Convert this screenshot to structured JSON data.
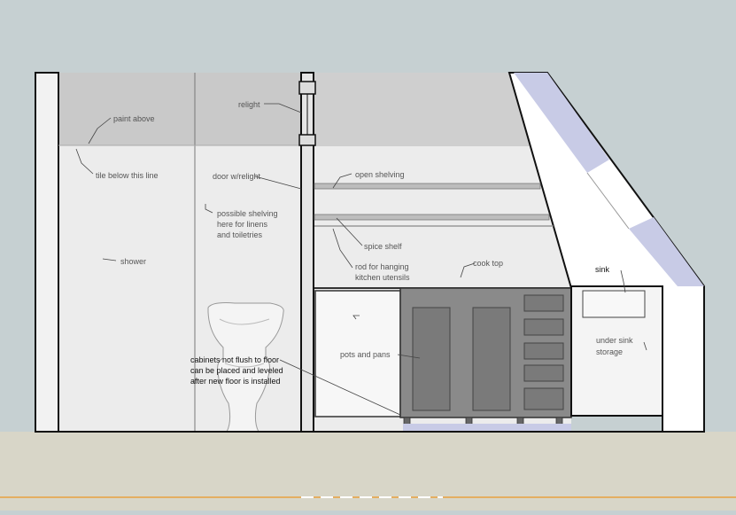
{
  "labels": {
    "paint_above": "paint above",
    "tile_below": "tile below this line",
    "shower": "shower",
    "relight": "relight",
    "door_relight": "door w/relight",
    "shelving": [
      "possible shelving",
      "here for linens",
      "and toiletries"
    ],
    "open_shelving": "open shelving",
    "spice_shelf": "spice shelf",
    "rod": [
      "rod for hanging",
      "kitchen utensils"
    ],
    "cook_top": "cook top",
    "pots_pans": "pots and pans",
    "sink": "sink",
    "under_sink": [
      "under sink",
      "storage"
    ],
    "cabinet_note": [
      "cabinets not flush to floor",
      "can be placed and leveled",
      "after new floor is installed"
    ]
  },
  "colors": {
    "sky": "#c6d0d2",
    "ground": "#d8d6c8",
    "paint_band": "#c9c9c9",
    "wall": "#ececec",
    "window": "#c8cbe6",
    "cabinet": "#8a8a8a",
    "accent_line": "#e8a040"
  }
}
